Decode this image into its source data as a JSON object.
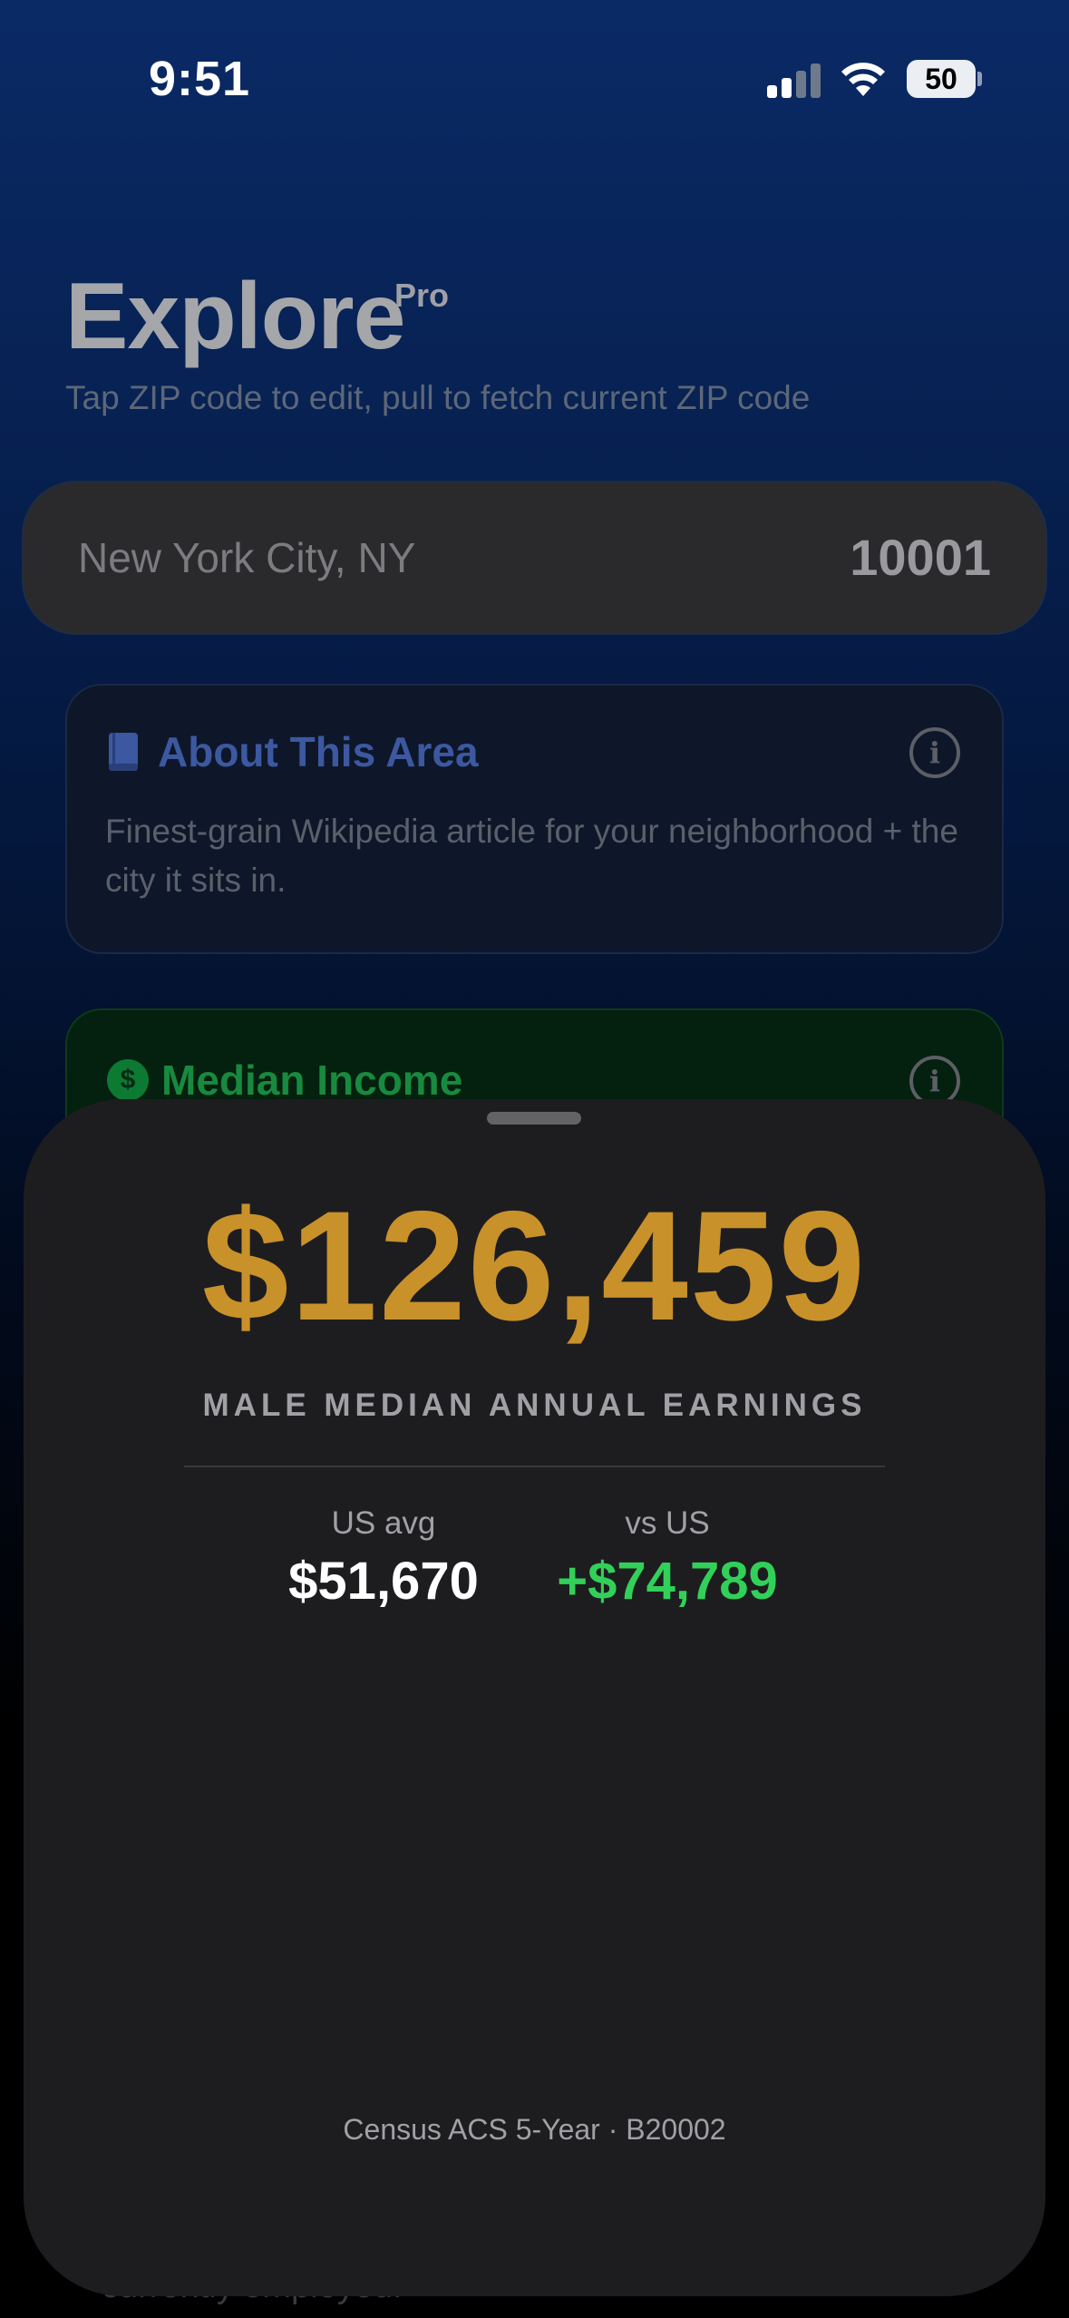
{
  "status_bar": {
    "time": "9:51",
    "battery": "50"
  },
  "header": {
    "title": "Explore",
    "badge": "Pro",
    "subtitle": "Tap ZIP code to edit, pull to fetch current ZIP code"
  },
  "location": {
    "city": "New York City, NY",
    "zip": "10001"
  },
  "cards": {
    "about": {
      "title": "About This Area",
      "description": "Finest-grain Wikipedia article for your neighborhood + the city it sits in.",
      "icon": "book-icon"
    },
    "income": {
      "title": "Median Income",
      "icon": "dollar-icon"
    }
  },
  "behind_text": "currently employed.",
  "sheet": {
    "value": "$126,459",
    "label": "MALE MEDIAN ANNUAL EARNINGS",
    "us_avg_label": "US avg",
    "us_avg_value": "$51,670",
    "vs_us_label": "vs US",
    "vs_us_value": "+$74,789",
    "source": "Census ACS 5-Year · B20002"
  },
  "colors": {
    "accent_gold": "#c9912a",
    "positive_green": "#31d159",
    "about_blue": "#3c58a0",
    "income_green": "#188a3f"
  }
}
